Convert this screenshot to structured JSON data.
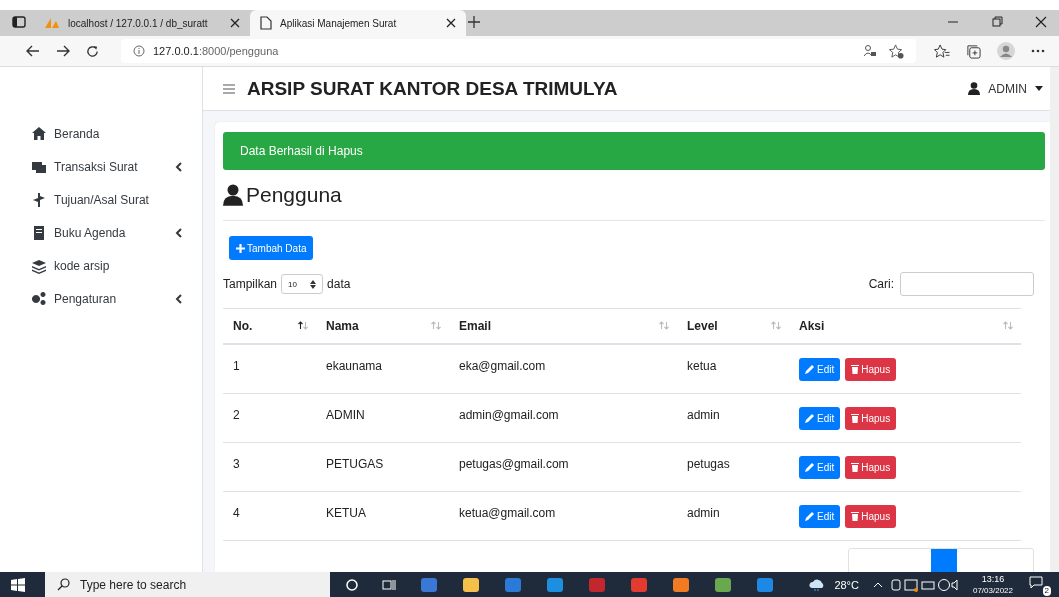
{
  "browser": {
    "tabs": [
      {
        "title": "localhost / 127.0.0.1 / db_suratt",
        "selected": false
      },
      {
        "title": "Aplikasi Manajemen Surat",
        "selected": true
      }
    ],
    "url_host": "127.0.0.1",
    "url_path": ":8000/pengguna"
  },
  "header": {
    "title": "ARSIP SURAT KANTOR DESA TRIMULYA",
    "user": "ADMIN"
  },
  "sidebar": {
    "items": [
      {
        "label": "Beranda",
        "has_submenu": false
      },
      {
        "label": "Transaksi Surat",
        "has_submenu": true
      },
      {
        "label": "Tujuan/Asal Surat",
        "has_submenu": false
      },
      {
        "label": "Buku Agenda",
        "has_submenu": true
      },
      {
        "label": "kode arsip",
        "has_submenu": false
      },
      {
        "label": "Pengaturan",
        "has_submenu": true
      }
    ]
  },
  "alert": "Data Berhasil di Hapus",
  "page_title": "Pengguna",
  "add_button": "Tambah Data",
  "length": {
    "label_before": "Tampilkan",
    "value": "10",
    "label_after": "data"
  },
  "search": {
    "label": "Cari:"
  },
  "table": {
    "columns": [
      {
        "label": "No.",
        "sorted": true
      },
      {
        "label": "Nama",
        "sorted": false
      },
      {
        "label": "Email",
        "sorted": false
      },
      {
        "label": "Level",
        "sorted": false
      },
      {
        "label": "Aksi",
        "sorted": false
      }
    ],
    "rows": [
      {
        "no": "1",
        "nama": "ekaunama",
        "email": "eka@gmail.com",
        "level": "ketua",
        "edit": "Edit",
        "delete": "Hapus"
      },
      {
        "no": "2",
        "nama": "ADMIN",
        "email": "admin@gmail.com",
        "level": "admin",
        "edit": "Edit",
        "delete": "Hapus"
      },
      {
        "no": "3",
        "nama": "PETUGAS",
        "email": "petugas@gmail.com",
        "level": "petugas",
        "edit": "Edit",
        "delete": "Hapus"
      },
      {
        "no": "4",
        "nama": "KETUA",
        "email": "ketua@gmail.com",
        "level": "admin",
        "edit": "Edit",
        "delete": "Hapus"
      }
    ]
  },
  "taskbar": {
    "search_placeholder": "Type here to search",
    "weather": "28°C",
    "time": "13:16",
    "date": "07/03/2022",
    "notifications": "2"
  }
}
